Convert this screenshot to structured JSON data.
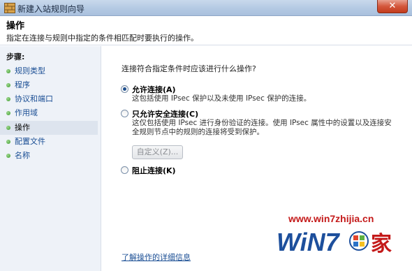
{
  "window": {
    "title": "新建入站规则向导",
    "close_glyph": "✕"
  },
  "header": {
    "title": "操作",
    "description": "指定在连接与规则中指定的条件相匹配时要执行的操作。"
  },
  "sidebar": {
    "steps_label": "步骤:",
    "items": [
      {
        "label": "规则类型"
      },
      {
        "label": "程序"
      },
      {
        "label": "协议和端口"
      },
      {
        "label": "作用域"
      },
      {
        "label": "操作",
        "active": true
      },
      {
        "label": "配置文件"
      },
      {
        "label": "名称"
      }
    ]
  },
  "main": {
    "question": "连接符合指定条件时应该进行什么操作?",
    "options": [
      {
        "label": "允许连接(A)",
        "checked": true,
        "desc": [
          "这包括使用 IPsec 保护以及未使用 IPsec 保护的连接。"
        ]
      },
      {
        "label": "只允许安全连接(C)",
        "checked": false,
        "desc": [
          "这仅包括使用 IPsec 进行身份验证的连接。使用 IPsec 属性中的设置以及连接安",
          "全规则节点中的规则的连接将受到保护。"
        ]
      },
      {
        "label": "阻止连接(K)",
        "checked": false,
        "desc": []
      }
    ],
    "custom_button": "自定义(Z)...",
    "details_link": "了解操作的详细信息"
  },
  "watermark": {
    "url": "www.win7zhijia.cn",
    "logo_text": "WiN7",
    "logo_suffix": "家"
  },
  "colors": {
    "accent_link": "#1a4e94",
    "watermark_red": "#c41a1a",
    "watermark_blue": "#1d4f9c"
  }
}
